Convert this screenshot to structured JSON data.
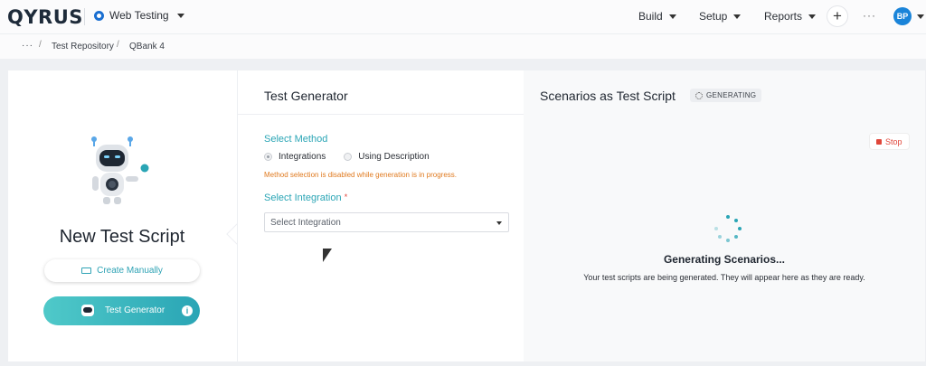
{
  "topbar": {
    "logo": "QYRUS",
    "project": "Web Testing",
    "nav": [
      "Build",
      "Setup",
      "Reports"
    ],
    "more": "···",
    "avatar": "BP"
  },
  "breadcrumb": {
    "more": "···",
    "items": [
      "Test Repository",
      "QBank 4"
    ]
  },
  "left": {
    "title": "New Test Script",
    "create_manually": "Create Manually",
    "test_generator": "Test Generator",
    "info": "i"
  },
  "middle": {
    "heading": "Test Generator",
    "select_method": "Select Method",
    "methods": [
      "Integrations",
      "Using Description"
    ],
    "selected_method": "Integrations",
    "warning": "Method selection is disabled while generation is in progress.",
    "select_integration": "Select Integration",
    "required_mark": "*",
    "integration_placeholder": "Select Integration"
  },
  "right": {
    "heading": "Scenarios as Test Script",
    "badge": "GENERATING",
    "stop": "Stop",
    "status_title": "Generating Scenarios...",
    "status_sub": "Your test scripts are being generated. They will appear here as they are ready."
  },
  "colors": {
    "accent": "#2aa5b5",
    "brand_blue": "#1a6fd1",
    "warning": "#e07a1f",
    "danger": "#e0463a"
  }
}
